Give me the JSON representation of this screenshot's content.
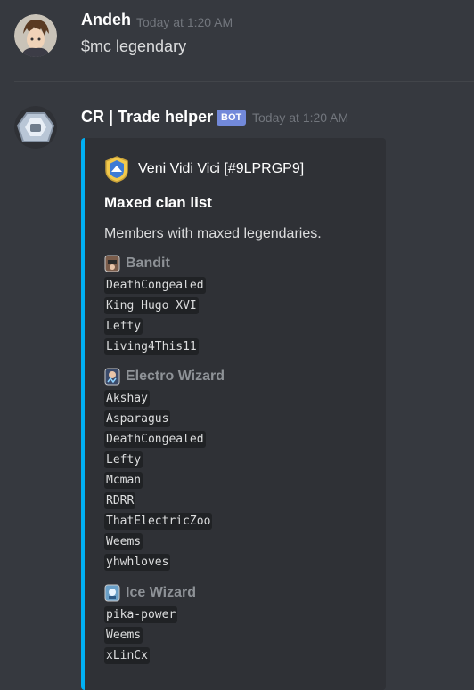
{
  "messages": [
    {
      "username": "Andeh",
      "timestamp": "Today at 1:20 AM",
      "content": "$mc legendary"
    },
    {
      "username": "CR | Trade helper",
      "bot_tag": "BOT",
      "timestamp": "Today at 1:20 AM",
      "embed": {
        "author": "Veni Vidi Vici [#9LPRGP9]",
        "title": "Maxed clan list",
        "description": "Members with maxed legendaries.",
        "accent_color": "#00b0f4",
        "fields": [
          {
            "name": "Bandit",
            "icon": "bandit-card-icon",
            "members": [
              "DeathCongealed",
              "King Hugo XVI",
              "Lefty",
              "Living4This11"
            ]
          },
          {
            "name": "Electro Wizard",
            "icon": "electro-wizard-card-icon",
            "members": [
              "Akshay",
              "Asparagus",
              "DeathCongealed",
              "Lefty",
              "Mcman",
              "RDRR",
              "ThatElectricZoo",
              "Weems",
              "yhwhloves"
            ]
          },
          {
            "name": "Ice Wizard",
            "icon": "ice-wizard-card-icon",
            "members": [
              "pika-power",
              "Weems",
              "xLinCx"
            ]
          }
        ]
      }
    }
  ]
}
